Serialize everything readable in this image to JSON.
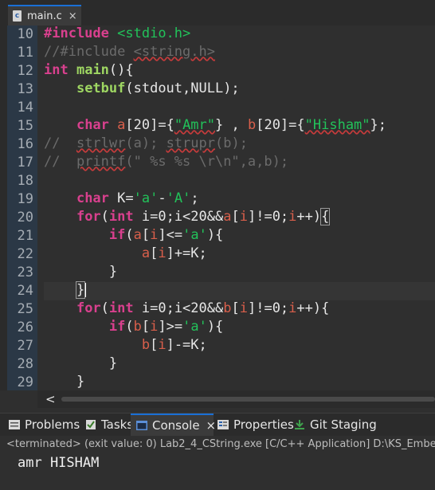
{
  "editor_tab": {
    "label": "main.c",
    "icon": "c-file-icon"
  },
  "line_numbers": [
    "10",
    "11",
    "12",
    "13",
    "14",
    "15",
    "16",
    "17",
    "18",
    "19",
    "20",
    "21",
    "22",
    "23",
    "24",
    "25",
    "26",
    "27",
    "28",
    "29"
  ],
  "code": {
    "l10": {
      "directive": "#include",
      "header": "<stdio.h>"
    },
    "l11": {
      "comment_start": "//#include ",
      "comment_header": "<string.h>"
    },
    "l12": {
      "kw": "int",
      "name": "main",
      "rest": "(){"
    },
    "l13": {
      "fn": "setbuf",
      "rest": "(stdout,NULL);"
    },
    "l15": {
      "kw": "char",
      "a": "a",
      "p1": "[20]={",
      "s1": "\"Amr\"",
      "p2": "} , ",
      "b": "b",
      "p3": "[20]={",
      "s2": "\"Hisham\"",
      "p4": "};"
    },
    "l16": {
      "c1": "//  ",
      "c2": "strlwr",
      "c3": "(a); ",
      "c4": "strupr",
      "c5": "(b);"
    },
    "l17": {
      "c1": "//  ",
      "c2": "printf",
      "c3": "(\" %s %s \\r\\n\",a,b);"
    },
    "l19": {
      "kw": "char",
      "v": " K=",
      "s1": "'a'",
      "op": "-",
      "s2": "'A'",
      "end": ";"
    },
    "l20": {
      "kw1": "for",
      "p1": "(",
      "kw2": "int",
      "p2": " i=0;i<20&&",
      "a1": "a",
      "p3": "[",
      "i1": "i",
      "p4": "]!=0;",
      "i2": "i",
      "p5": "++)",
      "br": "{"
    },
    "l21": {
      "kw": "if",
      "p1": "(",
      "a": "a",
      "p2": "[",
      "i": "i",
      "p3": "]<=",
      "s": "'a'",
      "p4": "){"
    },
    "l22": {
      "a": "a",
      "p1": "[",
      "i": "i",
      "p2": "]+=K;"
    },
    "l23": {
      "t": "}"
    },
    "l24": {
      "t": "}"
    },
    "l25": {
      "kw1": "for",
      "p1": "(",
      "kw2": "int",
      "p2": " i=0;i<20&&",
      "b1": "b",
      "p3": "[",
      "i1": "i",
      "p4": "]!=0;",
      "i2": "i",
      "p5": "++){"
    },
    "l26": {
      "kw": "if",
      "p1": "(",
      "b": "b",
      "p2": "[",
      "i": "i",
      "p3": "]>=",
      "s": "'a'",
      "p4": "){"
    },
    "l27": {
      "b": "b",
      "p1": "[",
      "i": "i",
      "p2": "]-=K;"
    },
    "l28": {
      "t": "}"
    },
    "l29": {
      "t": "}"
    }
  },
  "hscroll": {
    "left_arrow": "<"
  },
  "views": [
    {
      "label": "Problems",
      "icon": "problems-icon"
    },
    {
      "label": "Tasks",
      "icon": "tasks-icon"
    },
    {
      "label": "Console",
      "icon": "console-icon",
      "close": "×"
    },
    {
      "label": "Properties",
      "icon": "properties-icon"
    },
    {
      "label": "Git Staging",
      "icon": "git-staging-icon"
    }
  ],
  "console": {
    "status": "<terminated> (exit value: 0) Lab2_4_CString.exe [C/C++ Application] D:\\KS_Embe",
    "output": "amr HISHAM"
  },
  "colors": {
    "keyword": "#d9408e",
    "string": "#22c25a",
    "comment": "#6b6b6b",
    "function": "#9ed662",
    "accent": "#1a6fd6"
  }
}
